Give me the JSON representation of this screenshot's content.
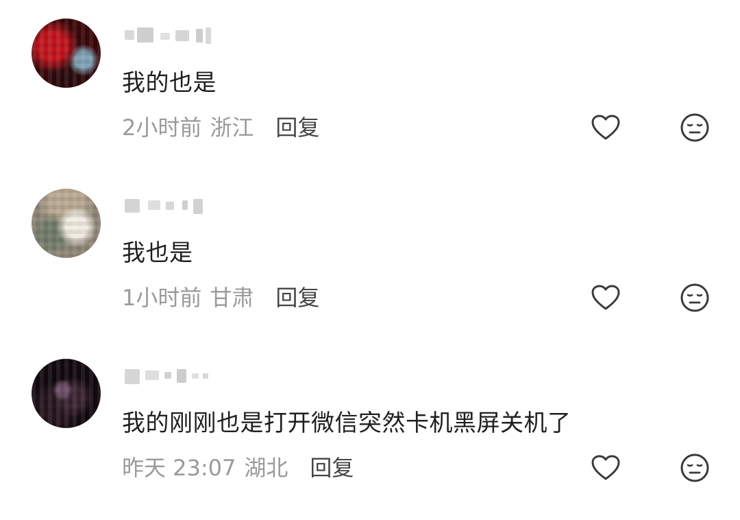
{
  "comments": [
    {
      "avatar": "avatar-red",
      "username_blurred": true,
      "text": "我的也是",
      "time": "2小时前",
      "location": "浙江",
      "reply_label": "回复",
      "like_icon": "heart-outline-icon",
      "reaction_icon": "neutral-face-icon"
    },
    {
      "avatar": "avatar-gray",
      "username_blurred": true,
      "text": "我也是",
      "time": "1小时前",
      "location": "甘肃",
      "reply_label": "回复",
      "like_icon": "heart-outline-icon",
      "reaction_icon": "neutral-face-icon"
    },
    {
      "avatar": "avatar-dark",
      "username_blurred": true,
      "text": "我的刚刚也是打开微信突然卡机黑屏关机了",
      "time": "昨天 23:07",
      "location": "湖北",
      "reply_label": "回复",
      "like_icon": "heart-outline-icon",
      "reaction_icon": "neutral-face-icon"
    }
  ],
  "colors": {
    "text": "#1f1f1f",
    "meta": "#9a9a9a",
    "reply": "#444444",
    "icon": "#3a3a3a",
    "background": "#ffffff"
  }
}
